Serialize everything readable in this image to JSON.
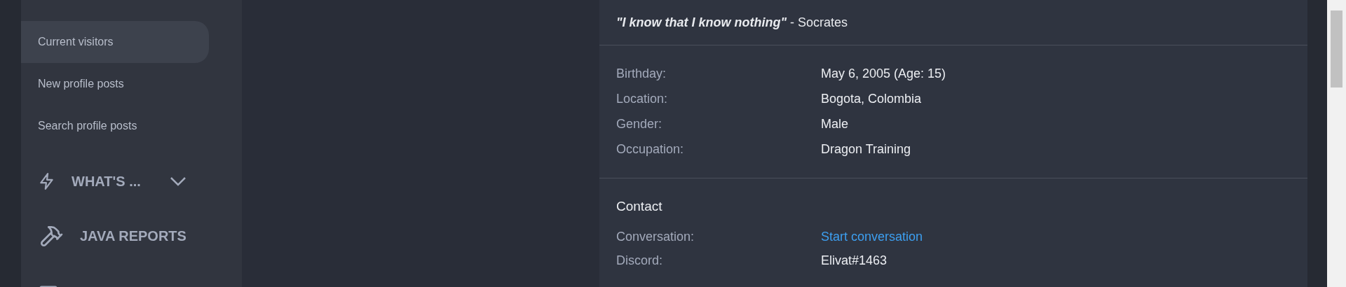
{
  "sidebar": {
    "links": [
      {
        "label": "Current visitors",
        "selected": true
      },
      {
        "label": "New profile posts",
        "selected": false
      },
      {
        "label": "Search profile posts",
        "selected": false
      }
    ],
    "sections": [
      {
        "label": "WHAT'S ...",
        "expandable": true
      },
      {
        "label": "JAVA REPORTS",
        "expandable": false
      }
    ]
  },
  "profile": {
    "quote": "\"I know that I know nothing\"",
    "attribution": "- Socrates",
    "details": [
      {
        "label": "Birthday:",
        "value": "May 6, 2005 (Age: 15)"
      },
      {
        "label": "Location:",
        "value": "Bogota, Colombia"
      },
      {
        "label": "Gender:",
        "value": "Male"
      },
      {
        "label": "Occupation:",
        "value": "Dragon Training"
      }
    ],
    "contact": {
      "title": "Contact",
      "rows": [
        {
          "label": "Conversation:",
          "value": "Start conversation",
          "kind": "link"
        },
        {
          "label": "Discord:",
          "value": "Elivat#1463",
          "kind": "text"
        }
      ]
    }
  }
}
